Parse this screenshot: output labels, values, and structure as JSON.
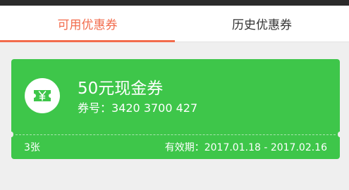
{
  "tabs": [
    {
      "label": "可用优惠券",
      "active": true
    },
    {
      "label": "历史优惠券",
      "active": false
    }
  ],
  "coupon": {
    "title": "50元现金券",
    "number_label": "券号：",
    "number": "3420 3700 427",
    "count": "3张",
    "validity_label": "有效期：",
    "validity": "2017.01.18 - 2017.02.16",
    "icon": "ticket-yen-icon"
  },
  "colors": {
    "accent": "#f26b4c",
    "coupon_bg": "#3ec64a",
    "page_bg": "#efefef"
  }
}
